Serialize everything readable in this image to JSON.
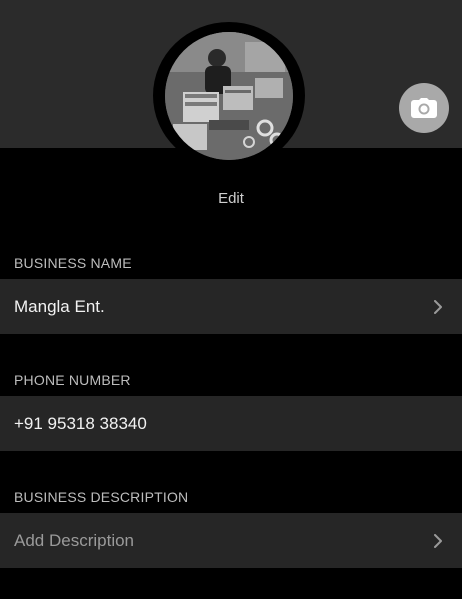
{
  "profile": {
    "edit_label": "Edit",
    "camera_icon": "camera-icon"
  },
  "fields": {
    "business_name": {
      "label": "BUSINESS NAME",
      "value": "Mangla Ent."
    },
    "phone_number": {
      "label": "PHONE NUMBER",
      "value": "+91 95318 38340"
    },
    "business_description": {
      "label": "BUSINESS DESCRIPTION",
      "placeholder": "Add Description"
    }
  },
  "icons": {
    "chevron": "chevron-right-icon"
  },
  "colors": {
    "background": "#000000",
    "header": "#2b2b2b",
    "row": "#262626",
    "label": "#bdbdbd",
    "camera_button": "#a9a9a9"
  }
}
